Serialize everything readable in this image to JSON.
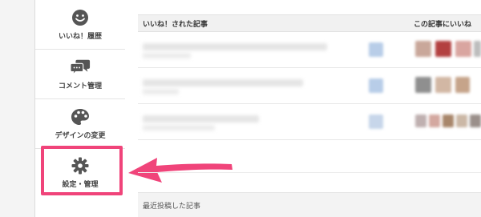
{
  "sidebar": {
    "items": [
      {
        "label": "いいね！履歴",
        "icon": "smiley-icon"
      },
      {
        "label": "コメント管理",
        "icon": "speech-bubbles-icon"
      },
      {
        "label": "デザインの変更",
        "icon": "palette-icon"
      },
      {
        "label": "設定・管理",
        "icon": "gear-icon"
      }
    ]
  },
  "table": {
    "col_article": "いいね！された記事",
    "col_likes": "この記事にいいね"
  },
  "recent_posts": {
    "label": "最近投稿した記事"
  },
  "colors": {
    "highlight": "#f0447a",
    "icon": "#555555"
  }
}
